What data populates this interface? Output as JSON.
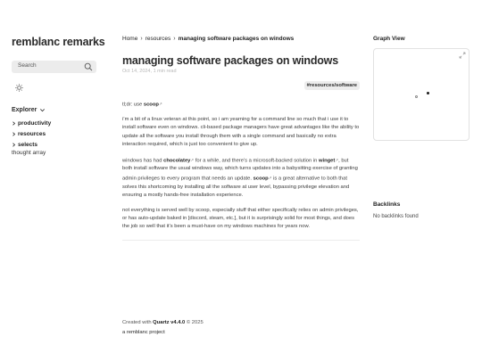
{
  "site": {
    "title": "remblanc remarks"
  },
  "search": {
    "label": "Search"
  },
  "explorer": {
    "heading": "Explorer",
    "folders": [
      "productivity",
      "resources",
      "selects"
    ],
    "files": [
      "thought array"
    ]
  },
  "breadcrumb": {
    "items": [
      "Home",
      "resources"
    ],
    "current": "managing software packages on windows"
  },
  "article": {
    "title": "managing software packages on windows",
    "date": "Oct 14, 2024,",
    "read_time": "1 min read",
    "tag": "#resources/software",
    "tldr_prefix": "tl;dr: use",
    "tldr_link": "scoop",
    "p1": "i’m a bit of a linux veteran at this point, so i am yearning for a command line so much that i use it to install software even on windows. cli-based package managers have great advantages like the ability to update all the software you install through them with a single command and basically no extra interaction required, which is just too convenient to give up.",
    "p2_a": "windows has had",
    "p2_link1": "chocolatey",
    "p2_b": "for a while, and there’s a microsoft-backed solution in",
    "p2_link2": "winget",
    "p2_c": ", but both install software the usual windows way, which turns updates into a babysitting exercise of granting admin privileges to every program that needs an update.",
    "p2_link3": "scoop",
    "p2_d": "is a great alternative to both that solves this shortcoming by installing all the software at user level, bypassing privilege elevation and ensuring a mostly hands-free installation experience.",
    "p3": "not everything is served well by scoop, especially stuff that either specifically relies on admin privileges, or has auto-update baked in [discord, steam, etc.], but it is surprisingly solid for most things, and does the job so well that it’s been a must-have on my windows machines for years now."
  },
  "footer": {
    "created_with": "Created with",
    "quartz": "Quartz v4.4.0",
    "year": "© 2025",
    "project": "a remblanc project"
  },
  "sidebar_right": {
    "graph_heading": "Graph View",
    "backlinks_heading": "Backlinks",
    "backlinks_empty": "No backlinks found"
  },
  "colors": {
    "text": "#2b2b2b",
    "muted": "#b8b8b8",
    "tag_bg": "#ededed",
    "search_bg": "#ececec"
  }
}
